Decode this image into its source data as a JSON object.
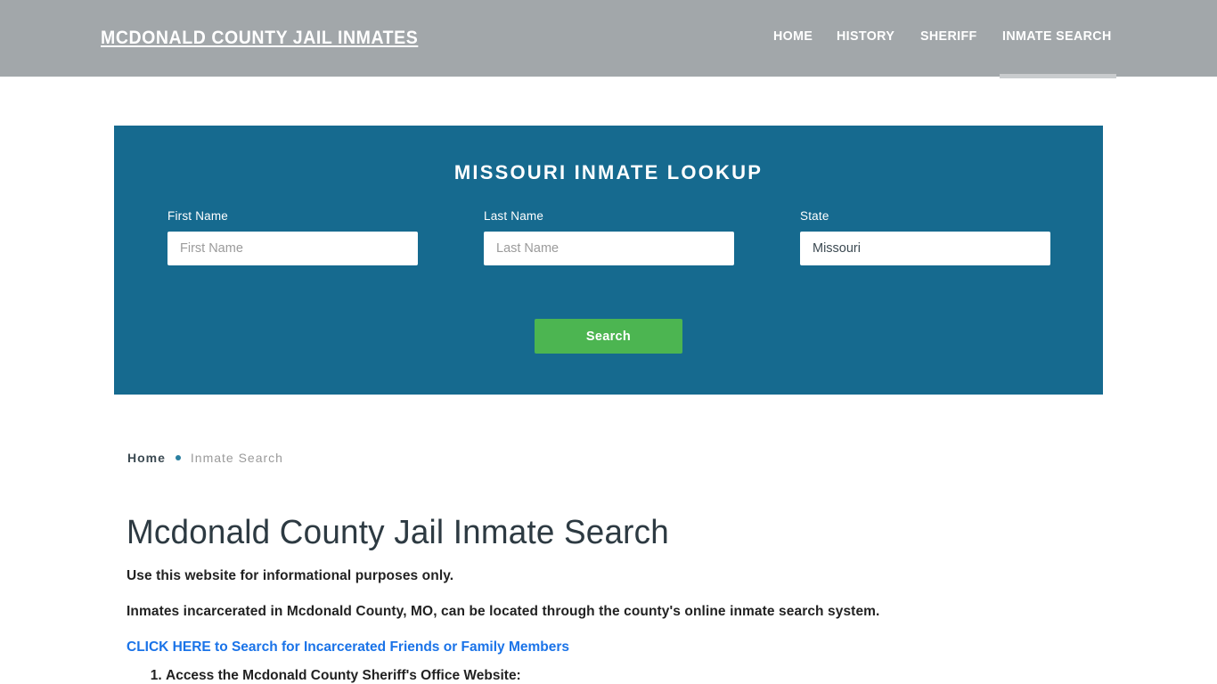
{
  "header": {
    "brand": "Mcdonald County Jail Inmates",
    "nav": [
      {
        "label": "Home"
      },
      {
        "label": "History"
      },
      {
        "label": "Sheriff"
      },
      {
        "label": "Inmate Search"
      }
    ]
  },
  "lookup": {
    "title": "Missouri Inmate Lookup",
    "fields": [
      {
        "label": "First Name",
        "placeholder": "First Name",
        "value": ""
      },
      {
        "label": "Last Name",
        "placeholder": "Last Name",
        "value": ""
      },
      {
        "label": "State",
        "placeholder": "State",
        "value": "Missouri"
      }
    ],
    "search_label": "Search"
  },
  "breadcrumb": {
    "home": "Home",
    "current": "Inmate Search"
  },
  "main": {
    "title": "Mcdonald County Jail Inmate Search",
    "paragraph_1": "Use this website for informational purposes only.",
    "paragraph_2": "Inmates incarcerated in Mcdonald County, MO, can be located through the county's online inmate search system.",
    "cta_link": "CLICK HERE to Search for Incarcerated Friends or Family Members",
    "steps": [
      "Access the Mcdonald County Sheriff's Office Website:"
    ]
  },
  "colors": {
    "header_bg": "#a2a7aa",
    "panel_bg": "#166a8f",
    "button_green": "#4cb551",
    "link_blue": "#1a73e8",
    "active_bar": "#c9ccce",
    "text_dark": "#222222",
    "crumb_dot": "#2a7fa0"
  }
}
